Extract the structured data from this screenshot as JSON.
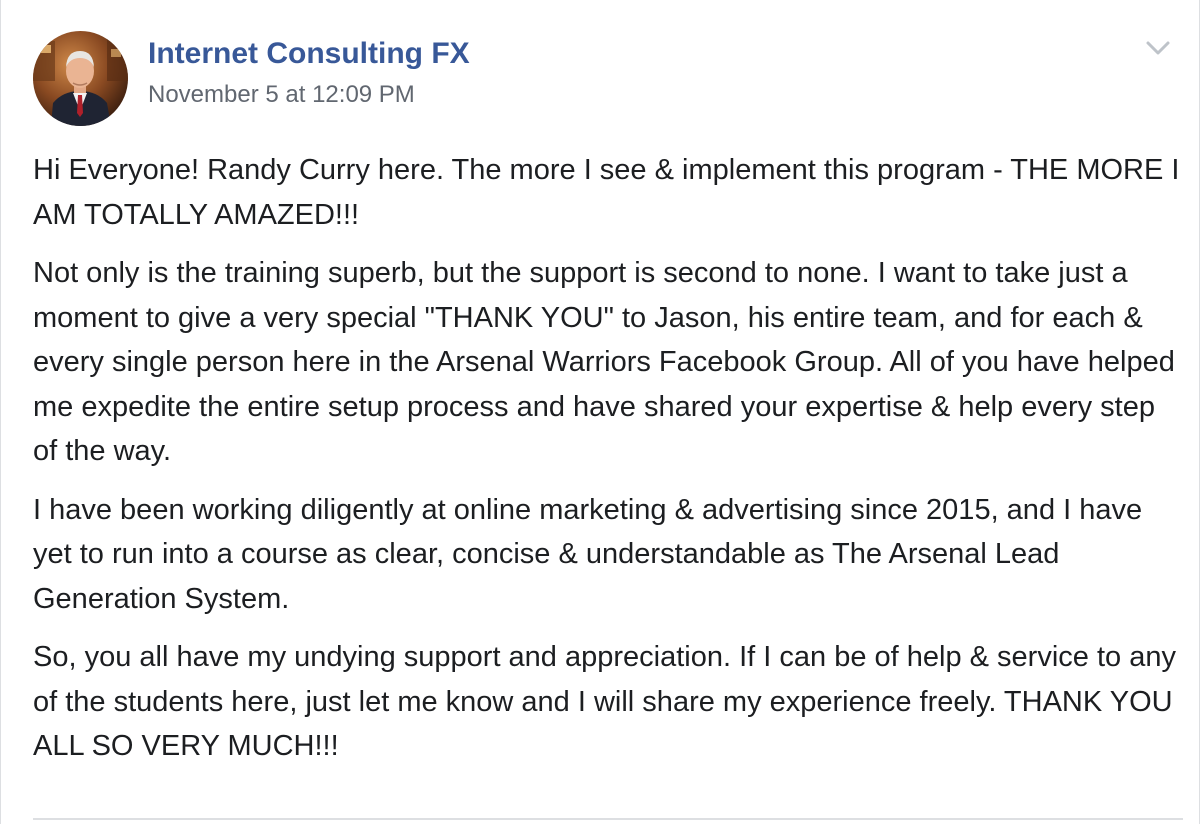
{
  "post": {
    "author": "Internet Consulting FX",
    "timestamp": "November 5 at 12:09 PM",
    "menu_icon": "chevron-down-icon",
    "paragraphs": [
      "Hi Everyone! Randy Curry here. The more I see & implement this program - THE MORE I AM TOTALLY AMAZED!!!",
      "Not only is the training superb, but the support is second to none. I want to take just a moment to give a very special \"THANK YOU\" to Jason, his entire team, and for each & every single person here in the Arsenal Warriors Facebook Group. All of you have helped me expedite the entire setup process and have shared your expertise & help every step of the way.",
      "I have been working diligently at online marketing & advertising since 2015, and I have yet to run into a course as clear, concise & understandable as The Arsenal Lead Generation System.",
      "So, you all have my undying support and appreciation. If I can be of help & service to any of the students here, just let me know and I will share my experience freely. THANK YOU ALL SO VERY MUCH!!!"
    ]
  },
  "colors": {
    "author_link": "#385898",
    "secondary_text": "#616770",
    "body_text": "#1c1e21",
    "divider": "#dddfe2"
  }
}
